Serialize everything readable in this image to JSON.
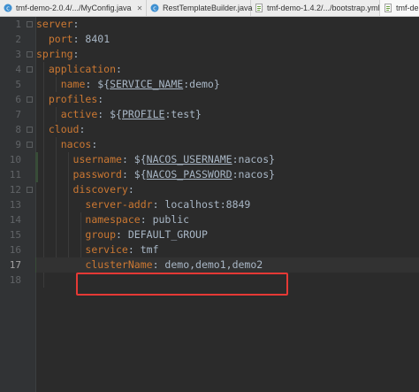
{
  "tabs": [
    {
      "label": "tmf-demo-2.0.4/.../MyConfig.java",
      "icon": "java-class-icon"
    },
    {
      "label": "RestTemplateBuilder.java",
      "icon": "java-class-icon"
    },
    {
      "label": "tmf-demo-1.4.2/.../bootstrap.yml",
      "icon": "yaml-file-icon"
    },
    {
      "label": "tmf-demo",
      "icon": "yaml-file-icon"
    }
  ],
  "line_numbers": [
    "1",
    "2",
    "3",
    "4",
    "5",
    "6",
    "7",
    "8",
    "9",
    "10",
    "11",
    "12",
    "13",
    "14",
    "15",
    "16",
    "17",
    "18"
  ],
  "current_line": "17",
  "code": {
    "l1": {
      "key": "server",
      "colon": ":"
    },
    "l2": {
      "key": "port",
      "colon": ":",
      "value": " 8401"
    },
    "l3": {
      "key": "spring",
      "colon": ":"
    },
    "l4": {
      "key": "application",
      "colon": ":"
    },
    "l5": {
      "key": "name",
      "colon": ":",
      "pre": " ${",
      "var": "SERVICE_NAME",
      "post": ":demo}"
    },
    "l6": {
      "key": "profiles",
      "colon": ":"
    },
    "l7": {
      "key": "active",
      "colon": ":",
      "pre": " ${",
      "var": "PROFILE",
      "post": ":test}"
    },
    "l8": {
      "key": "cloud",
      "colon": ":"
    },
    "l9": {
      "key": "nacos",
      "colon": ":"
    },
    "l10": {
      "key": "username",
      "colon": ":",
      "pre": " ${",
      "var": "NACOS_USERNAME",
      "post": ":nacos}"
    },
    "l11": {
      "key": "password",
      "colon": ":",
      "pre": " ${",
      "var": "NACOS_PASSWORD",
      "post": ":nacos}"
    },
    "l12": {
      "key": "discovery",
      "colon": ":"
    },
    "l13": {
      "key": "server-addr",
      "colon": ":",
      "value": " localhost:8849"
    },
    "l14": {
      "key": "namespace",
      "colon": ":",
      "value": " public"
    },
    "l15": {
      "key": "group",
      "colon": ":",
      "value": " DEFAULT_GROUP"
    },
    "l16": {
      "key": "service",
      "colon": ":",
      "value": " tmf"
    },
    "l17": {
      "key": "clusterName",
      "colon": ":",
      "value": " demo,demo1,demo2"
    }
  },
  "colors": {
    "key": "#cc7832",
    "value": "#a9b7c6",
    "highlight_box": "#e53935",
    "background": "#2b2b2b"
  }
}
